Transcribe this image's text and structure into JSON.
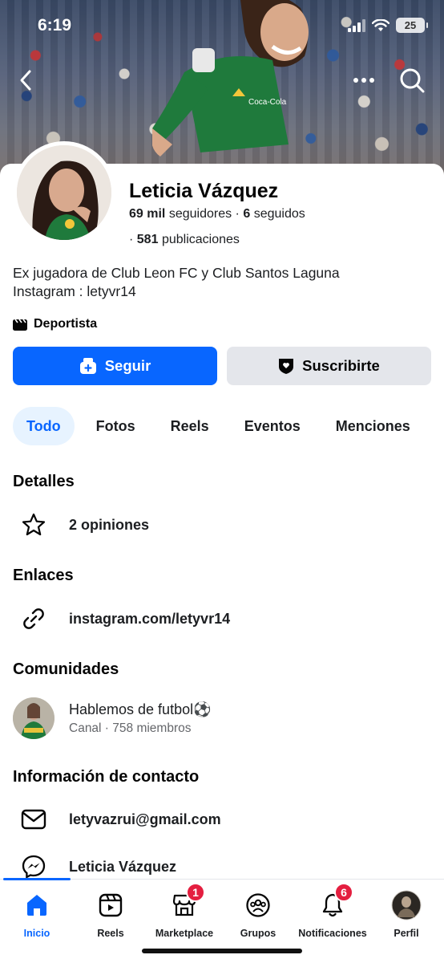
{
  "status": {
    "time": "6:19",
    "battery": "25"
  },
  "profile": {
    "name": "Leticia Vázquez",
    "followers_count": "69 mil",
    "followers_label": "seguidores",
    "following_count": "6",
    "following_label": "seguidos",
    "posts_count": "581",
    "posts_label": "publicaciones",
    "bio_line1": "Ex jugadora de Club Leon FC y Club Santos Laguna",
    "bio_line2": "Instagram : letyvr14",
    "category": "Deportista"
  },
  "actions": {
    "follow_label": "Seguir",
    "subscribe_label": "Suscribirte"
  },
  "tabs": [
    {
      "label": "Todo",
      "active": true
    },
    {
      "label": "Fotos"
    },
    {
      "label": "Reels"
    },
    {
      "label": "Eventos"
    },
    {
      "label": "Menciones"
    }
  ],
  "details": {
    "title": "Detalles",
    "reviews": "2 opiniones"
  },
  "links": {
    "title": "Enlaces",
    "instagram": "instagram.com/letyvr14"
  },
  "communities": {
    "title": "Comunidades",
    "name": "Hablemos de futbol⚽",
    "subtitle": "Canal · 758 miembros"
  },
  "contact": {
    "title": "Información de contacto",
    "email": "letyvazrui@gmail.com",
    "messenger": "Leticia Vázquez"
  },
  "bottom_nav": [
    {
      "label": "Inicio",
      "icon": "home-icon",
      "active": true
    },
    {
      "label": "Reels",
      "icon": "reels-icon"
    },
    {
      "label": "Marketplace",
      "icon": "marketplace-icon",
      "badge": "1"
    },
    {
      "label": "Grupos",
      "icon": "groups-icon"
    },
    {
      "label": "Notificaciones",
      "icon": "bell-icon",
      "badge": "6"
    },
    {
      "label": "Perfil",
      "icon": "profile-avatar"
    }
  ],
  "colors": {
    "primary": "#0866ff",
    "badge": "#e41e3f",
    "jersey": "#1f7a3c"
  }
}
